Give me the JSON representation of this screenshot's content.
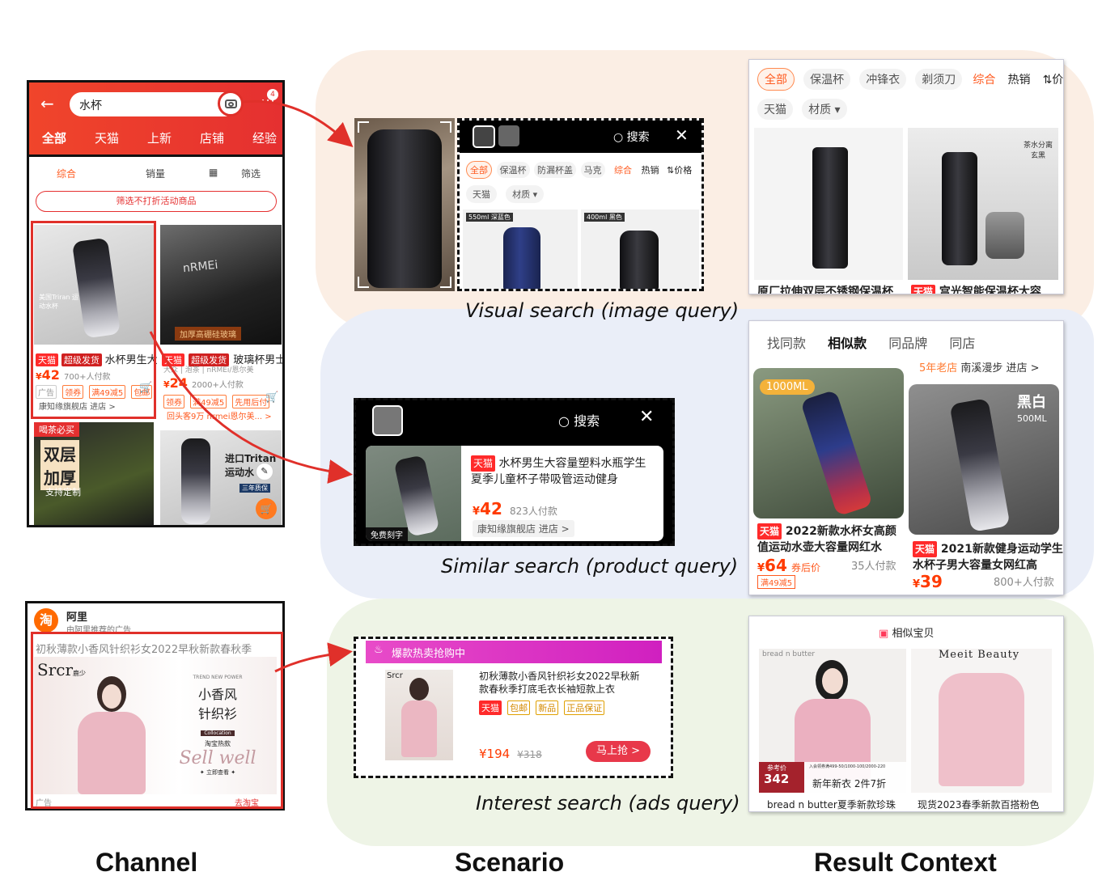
{
  "columns": {
    "channel": "Channel",
    "scenario": "Scenario",
    "result": "Result Context"
  },
  "scenarios": {
    "visual": "Visual search (image query)",
    "similar": "Similar search (product query)",
    "interest": "Interest search (ads query)"
  },
  "colors": {
    "accent_red": "#e0302a",
    "orange": "#ff5a1f",
    "blob_visual": "#fbeee4",
    "blob_similar": "#eaeef8",
    "blob_interest": "#eef4e6"
  },
  "phone1": {
    "search_text": "水杯",
    "badge": "4",
    "tabs": [
      "全部",
      "天猫",
      "上新",
      "店铺",
      "经验"
    ],
    "sort": [
      "综合",
      "销量",
      "筛选"
    ],
    "filter_button": "筛选不打折活动商品",
    "p1_tags": [
      "天猫",
      "超级发货"
    ],
    "p1_title": "水杯男生大",
    "p1_price": "42",
    "p1_sold": "700+人付款",
    "p1_coupons": [
      "广告",
      "领券",
      "满49减5",
      "包邮"
    ],
    "p1_shop": "康知缘旗舰店 进店 >",
    "p1_overlay": "美国Triran 运动水杯",
    "p2_title": "玻璃杯男士",
    "p2_brand": "nRMEi",
    "p2_sub": "大众 | 泡茶 | nRMEi/恩尔美",
    "p2_banner": "加厚高硼硅玻璃",
    "p2_price": "24",
    "p2_sold": "2000+人付款",
    "p2_coupons": [
      "领券",
      "满49减5",
      "先用后付"
    ],
    "p2_shop": "回头客9万 nrmei恩尔美... >",
    "p3_badge": "喝茶必买",
    "p3_big1": "双层",
    "p3_big2": "加厚",
    "p3_sub": "支持定制",
    "p4_title": "进口Tritan 运动水",
    "p4_sub": "三年质保"
  },
  "phone2": {
    "shop": "阿里",
    "sub": "由阿里推荐的广告",
    "headline": "初秋薄款小香风针织衫女2022早秋新款春秋季",
    "brand": "Srcr",
    "brand_cn": "鹿少",
    "promo_small": "TREND NEW POWER",
    "promo_title1": "小香风",
    "promo_title2": "针织衫",
    "promo_tag": "Collocation",
    "promo_sub": "淘宝热款",
    "promo_script": "Sell well",
    "promo_cta": "✦ 立即查看 ✦",
    "ad": "广告",
    "go": "去淘宝"
  },
  "visual_panel": {
    "search": "搜索",
    "chips1": [
      "全部",
      "保温杯",
      "防漏杯盖",
      "马克",
      "综合",
      "热销",
      "价格"
    ],
    "chips2": [
      "天猫",
      "材质"
    ],
    "p1_tag": "550ml 深蓝色",
    "p2_tag": "400ml 黑色"
  },
  "similar_panel": {
    "search": "搜索",
    "tag": "天猫",
    "title": "水杯男生大容量塑料水瓶学生夏季儿童杯子带吸管运动健身",
    "price": "42",
    "sold": "823人付款",
    "shop": "康知缘旗舰店 进店 >",
    "engrave": "免费刻字"
  },
  "interest_panel": {
    "header": "爆款热卖抢购中",
    "brand": "Srcr",
    "title": "初秋薄款小香风针织衫女2022早秋新款春秋季打底毛衣长袖短款上衣",
    "tags": [
      "天猫",
      "包邮",
      "新品",
      "正品保证"
    ],
    "price": "¥194",
    "old_price": "¥318",
    "cta": "马上抢 >"
  },
  "result_visual": {
    "chips1": [
      "全部",
      "保温杯",
      "冲锋衣",
      "剃须刀",
      "综合",
      "热销",
      "价格"
    ],
    "chips2": [
      "天猫",
      "材质"
    ],
    "p1_title": "原厂拉伸双层不锈钢保温杯",
    "p2_tag": "天猫",
    "p2_title": "宫光智能保温杯大容",
    "p2_overlay": "茶水分离 玄黑"
  },
  "result_similar": {
    "tabs": [
      "找同款",
      "相似款",
      "同品牌",
      "同店"
    ],
    "shop_tag": "5年老店",
    "shop": "南溪漫步 进店 >",
    "p1_badge": "1000ML",
    "p1_tag": "天猫",
    "p1_title": "2022新款水杯女高颜值运动水壶大容量网红水",
    "p1_price": "64",
    "p1_after": "券后价",
    "p1_sold": "35人付款",
    "p1_coupon": "满49减5",
    "p2_badge1": "黑白",
    "p2_badge2": "500ML",
    "p2_tag": "天猫",
    "p2_title": "2021新款健身运动学生水杯子男大容量女网红高",
    "p2_price": "39",
    "p2_sold": "800+人付款"
  },
  "result_interest": {
    "header": "相似宝贝",
    "p1_brand": "bread n butter",
    "p1_ref": "参考价",
    "p1_price": "342",
    "p1_promo_small": "入会领券满499-50/1000-100/2000-220",
    "p1_promo": "新年新衣  2件7折",
    "p1_title": "bread n butter夏季新款珍珠",
    "p2_brand": "Meeit Beauty",
    "p2_title": "现货2023春季新款百搭粉色"
  }
}
